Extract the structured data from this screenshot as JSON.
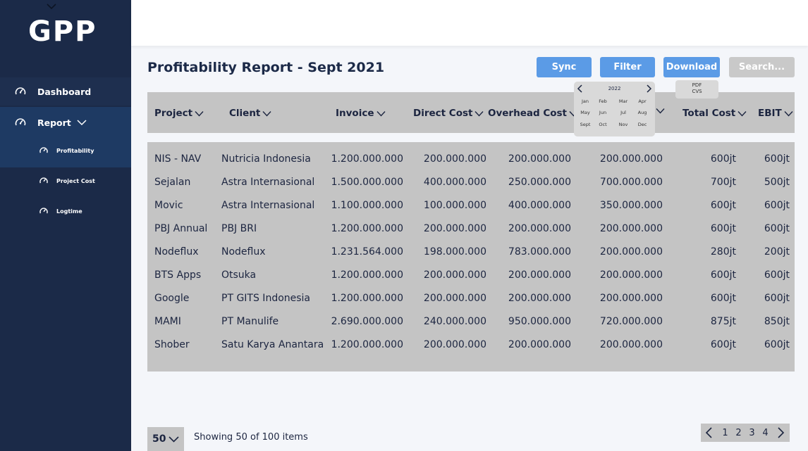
{
  "app": {
    "logo": "GPP"
  },
  "sidebar": {
    "items": [
      {
        "label": "Dashboard",
        "icon": "speedometer-icon"
      },
      {
        "label": "Report",
        "icon": "speedometer-icon",
        "expanded": true
      }
    ],
    "sub_items": [
      {
        "label": "Profitability",
        "icon": "speedometer-icon",
        "active": true
      },
      {
        "label": "Project Cost",
        "icon": "speedometer-icon"
      },
      {
        "label": "Logtime",
        "icon": "speedometer-icon"
      }
    ]
  },
  "header": {
    "title": "Profitability Report - Sept 2021",
    "sync_label": "Sync",
    "filter_label": "Filter",
    "download_label": "Download",
    "search_placeholder": "Search..."
  },
  "download_menu": [
    "PDF",
    "CVS"
  ],
  "month_picker": {
    "year": "2022",
    "months": [
      "Jan",
      "Feb",
      "Mar",
      "Apr",
      "May",
      "Jun",
      "Jul",
      "Aug",
      "Sept",
      "Oct",
      "Nov",
      "Dec"
    ]
  },
  "table": {
    "columns": [
      "Project",
      "Client",
      "Invoice",
      "Direct Cost",
      "Overhead Cost",
      "",
      "Total Cost",
      "EBIT"
    ],
    "rows": [
      [
        "NIS - NAV",
        "Nutricia Indonesia",
        "1.200.000.000",
        "200.000.000",
        "200.000.000",
        "200.000.000",
        "600jt",
        "600jt"
      ],
      [
        "Sejalan",
        "Astra Internasional",
        "1.500.000.000",
        "400.000.000",
        "250.000.000",
        "700.000.000",
        "700jt",
        "500jt"
      ],
      [
        "Movic",
        "Astra Internasional",
        "1.100.000.000",
        "100.000.000",
        "400.000.000",
        "350.000.000",
        "600jt",
        "600jt"
      ],
      [
        "PBJ Annual",
        "PBJ BRI",
        "1.200.000.000",
        "200.000.000",
        "200.000.000",
        "200.000.000",
        "600jt",
        "600jt"
      ],
      [
        "Nodeflux",
        "Nodeflux",
        "1.231.564.000",
        "198.000.000",
        "783.000.000",
        "200.000.000",
        "280jt",
        "200jt"
      ],
      [
        "BTS Apps",
        "Otsuka",
        "1.200.000.000",
        "200.000.000",
        "200.000.000",
        "200.000.000",
        "600jt",
        "600jt"
      ],
      [
        "Google",
        "PT GITS Indonesia",
        "1.200.000.000",
        "200.000.000",
        "200.000.000",
        "200.000.000",
        "600jt",
        "600jt"
      ],
      [
        "MAMI",
        "PT Manulife",
        "2.690.000.000",
        "240.000.000",
        "950.000.000",
        "720.000.000",
        "875jt",
        "850jt"
      ],
      [
        "Shober",
        "Satu Karya Anantara",
        "1.200.000.000",
        "200.000.000",
        "200.000.000",
        "200.000.000",
        "600jt",
        "600jt"
      ]
    ]
  },
  "footer": {
    "per_page": "50",
    "showing_text": "Showing 50 of 100 items",
    "pages": [
      "1",
      "2",
      "3",
      "4"
    ]
  }
}
